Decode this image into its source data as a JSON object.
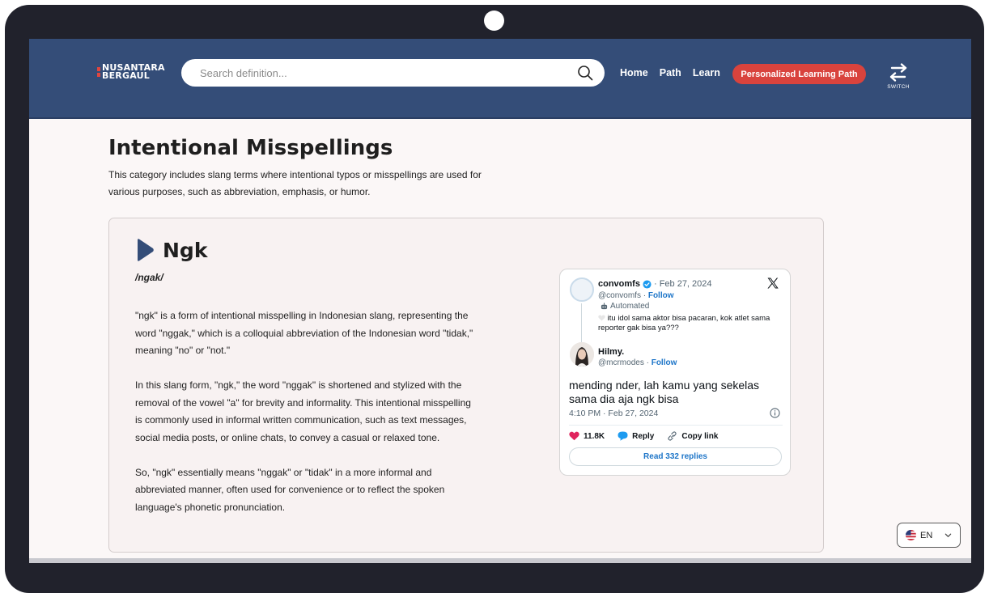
{
  "brand": {
    "line1": "NUSANTARA",
    "line2": "BERGAUL"
  },
  "search": {
    "placeholder": "Search definition..."
  },
  "nav": {
    "links": [
      "Home",
      "Path",
      "Learn"
    ],
    "cta": "Personalized Learning Path",
    "switch_label": "SWITCH"
  },
  "page": {
    "title": "Intentional Misspellings",
    "description": "This category includes slang terms where intentional typos or misspellings are used for various purposes, such as abbreviation, emphasis, or humor."
  },
  "entry": {
    "word": "Ngk",
    "pronunciation": "/ngak/",
    "paragraphs": [
      "\"ngk\" is a form of intentional misspelling in Indonesian slang, representing the word \"nggak,\" which is a colloquial abbreviation of the Indonesian word \"tidak,\" meaning \"no\" or \"not.\"",
      "In this slang form, \"ngk,\" the word \"nggak\" is shortened and stylized with the removal of the vowel \"a\" for brevity and informality. This intentional misspelling is commonly used in informal written communication, such as text messages, social media posts, or online chats, to convey a casual or relaxed tone.",
      "So, \"ngk\" essentially means \"nggak\" or \"tidak\" in a more informal and abbreviated manner, often used for convenience or to reflect the spoken language's phonetic pronunciation."
    ]
  },
  "tweet": {
    "quoted": {
      "name": "convomfs",
      "date": "· Feb 27, 2024",
      "handle": "@convomfs · ",
      "follow": "Follow",
      "automated": "Automated",
      "text": "itu idol sama aktor bisa pacaran, kok atlet sama reporter gak bisa ya???"
    },
    "author": {
      "name": "Hilmy.",
      "handle": "@mcrmodes · ",
      "follow": "Follow"
    },
    "body": "mending nder, lah kamu yang sekelas sama dia aja ngk bisa",
    "time": "4:10 PM · Feb 27, 2024",
    "likes": "11.8K",
    "reply": "Reply",
    "copy_link": "Copy link",
    "read_replies": "Read 332 replies"
  },
  "language": {
    "selected": "EN"
  },
  "colors": {
    "header": "#344d78",
    "accent": "#d9433d",
    "page_bg": "#fbf7f7",
    "like": "#e0245e",
    "link": "#1d75c8"
  }
}
